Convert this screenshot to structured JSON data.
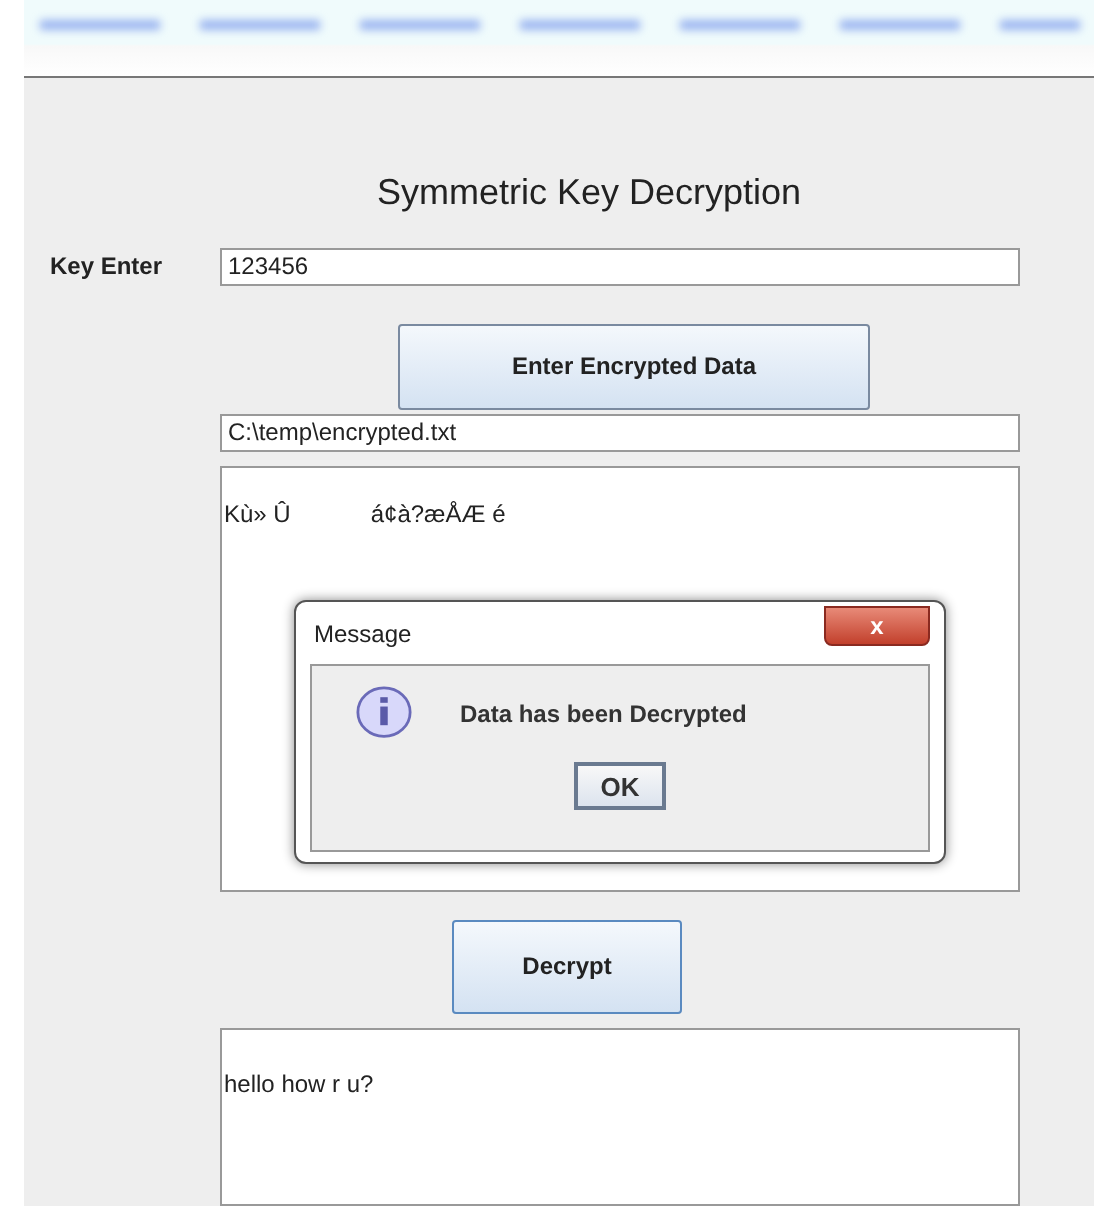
{
  "title": "Symmetric Key Decryption",
  "key": {
    "label": "Key Enter",
    "value": "123456"
  },
  "load_button": "Enter Encrypted Data",
  "file_path": "C:\\temp\\encrypted.txt",
  "encrypted_text": "Kù» Û            á¢à?æÅÆ é",
  "decrypt_button": "Decrypt",
  "decrypted_text": "hello how r u?",
  "dialog": {
    "title": "Message",
    "close": "x",
    "message": "Data has been Decrypted",
    "button": "OK"
  }
}
